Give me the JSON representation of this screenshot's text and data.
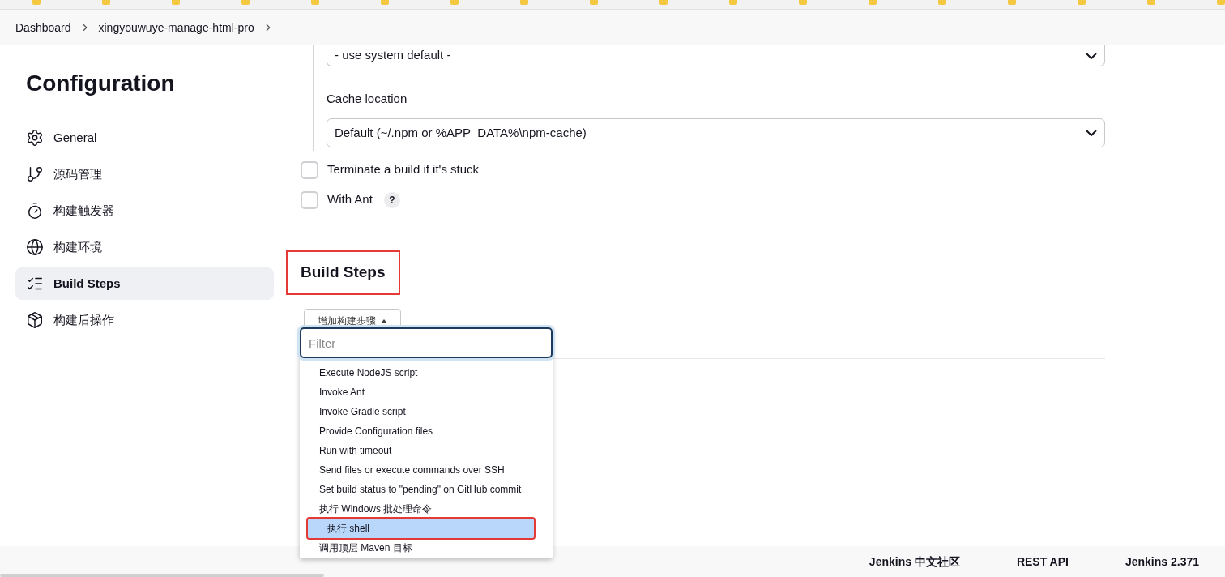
{
  "breadcrumbs": [
    "Dashboard",
    "xingyouwuye-manage-html-pro"
  ],
  "sidebar": {
    "title": "Configuration",
    "items": [
      {
        "label": "General",
        "selected": false
      },
      {
        "label": "源码管理",
        "selected": false
      },
      {
        "label": "构建触发器",
        "selected": false
      },
      {
        "label": "构建环境",
        "selected": false
      },
      {
        "label": "Build Steps",
        "selected": true
      },
      {
        "label": "构建后操作",
        "selected": false
      }
    ]
  },
  "main": {
    "version_select": {
      "value": "- use system default -"
    },
    "cache_location": {
      "label": "Cache location",
      "value": "Default (~/.npm or %APP_DATA%\\npm-cache)"
    },
    "options": [
      {
        "label": "Terminate a build if it's stuck",
        "checked": false
      },
      {
        "label": "With Ant",
        "checked": false,
        "help_label": "?"
      }
    ],
    "build_steps": {
      "title": "Build Steps",
      "annotated": true,
      "add_button": "增加构建步骤",
      "menu": {
        "filter_placeholder": "Filter",
        "items": [
          {
            "label": "Execute NodeJS script",
            "selected": false,
            "annotated": false
          },
          {
            "label": "Invoke Ant",
            "selected": false,
            "annotated": false
          },
          {
            "label": "Invoke Gradle script",
            "selected": false,
            "annotated": false
          },
          {
            "label": "Provide Configuration files",
            "selected": false,
            "annotated": false
          },
          {
            "label": "Run with timeout",
            "selected": false,
            "annotated": false
          },
          {
            "label": "Send files or execute commands over SSH",
            "selected": false,
            "annotated": false
          },
          {
            "label": "Set build status to \"pending\" on GitHub commit",
            "selected": false,
            "annotated": false
          },
          {
            "label": "执行 Windows 批处理命令",
            "selected": false,
            "annotated": false
          },
          {
            "label": "执行 shell",
            "selected": true,
            "annotated": true
          },
          {
            "label": "调用顶层 Maven 目标",
            "selected": false,
            "annotated": false
          }
        ]
      }
    }
  },
  "footer": {
    "links": [
      "Jenkins 中文社区",
      "REST API",
      "Jenkins 2.371"
    ]
  }
}
